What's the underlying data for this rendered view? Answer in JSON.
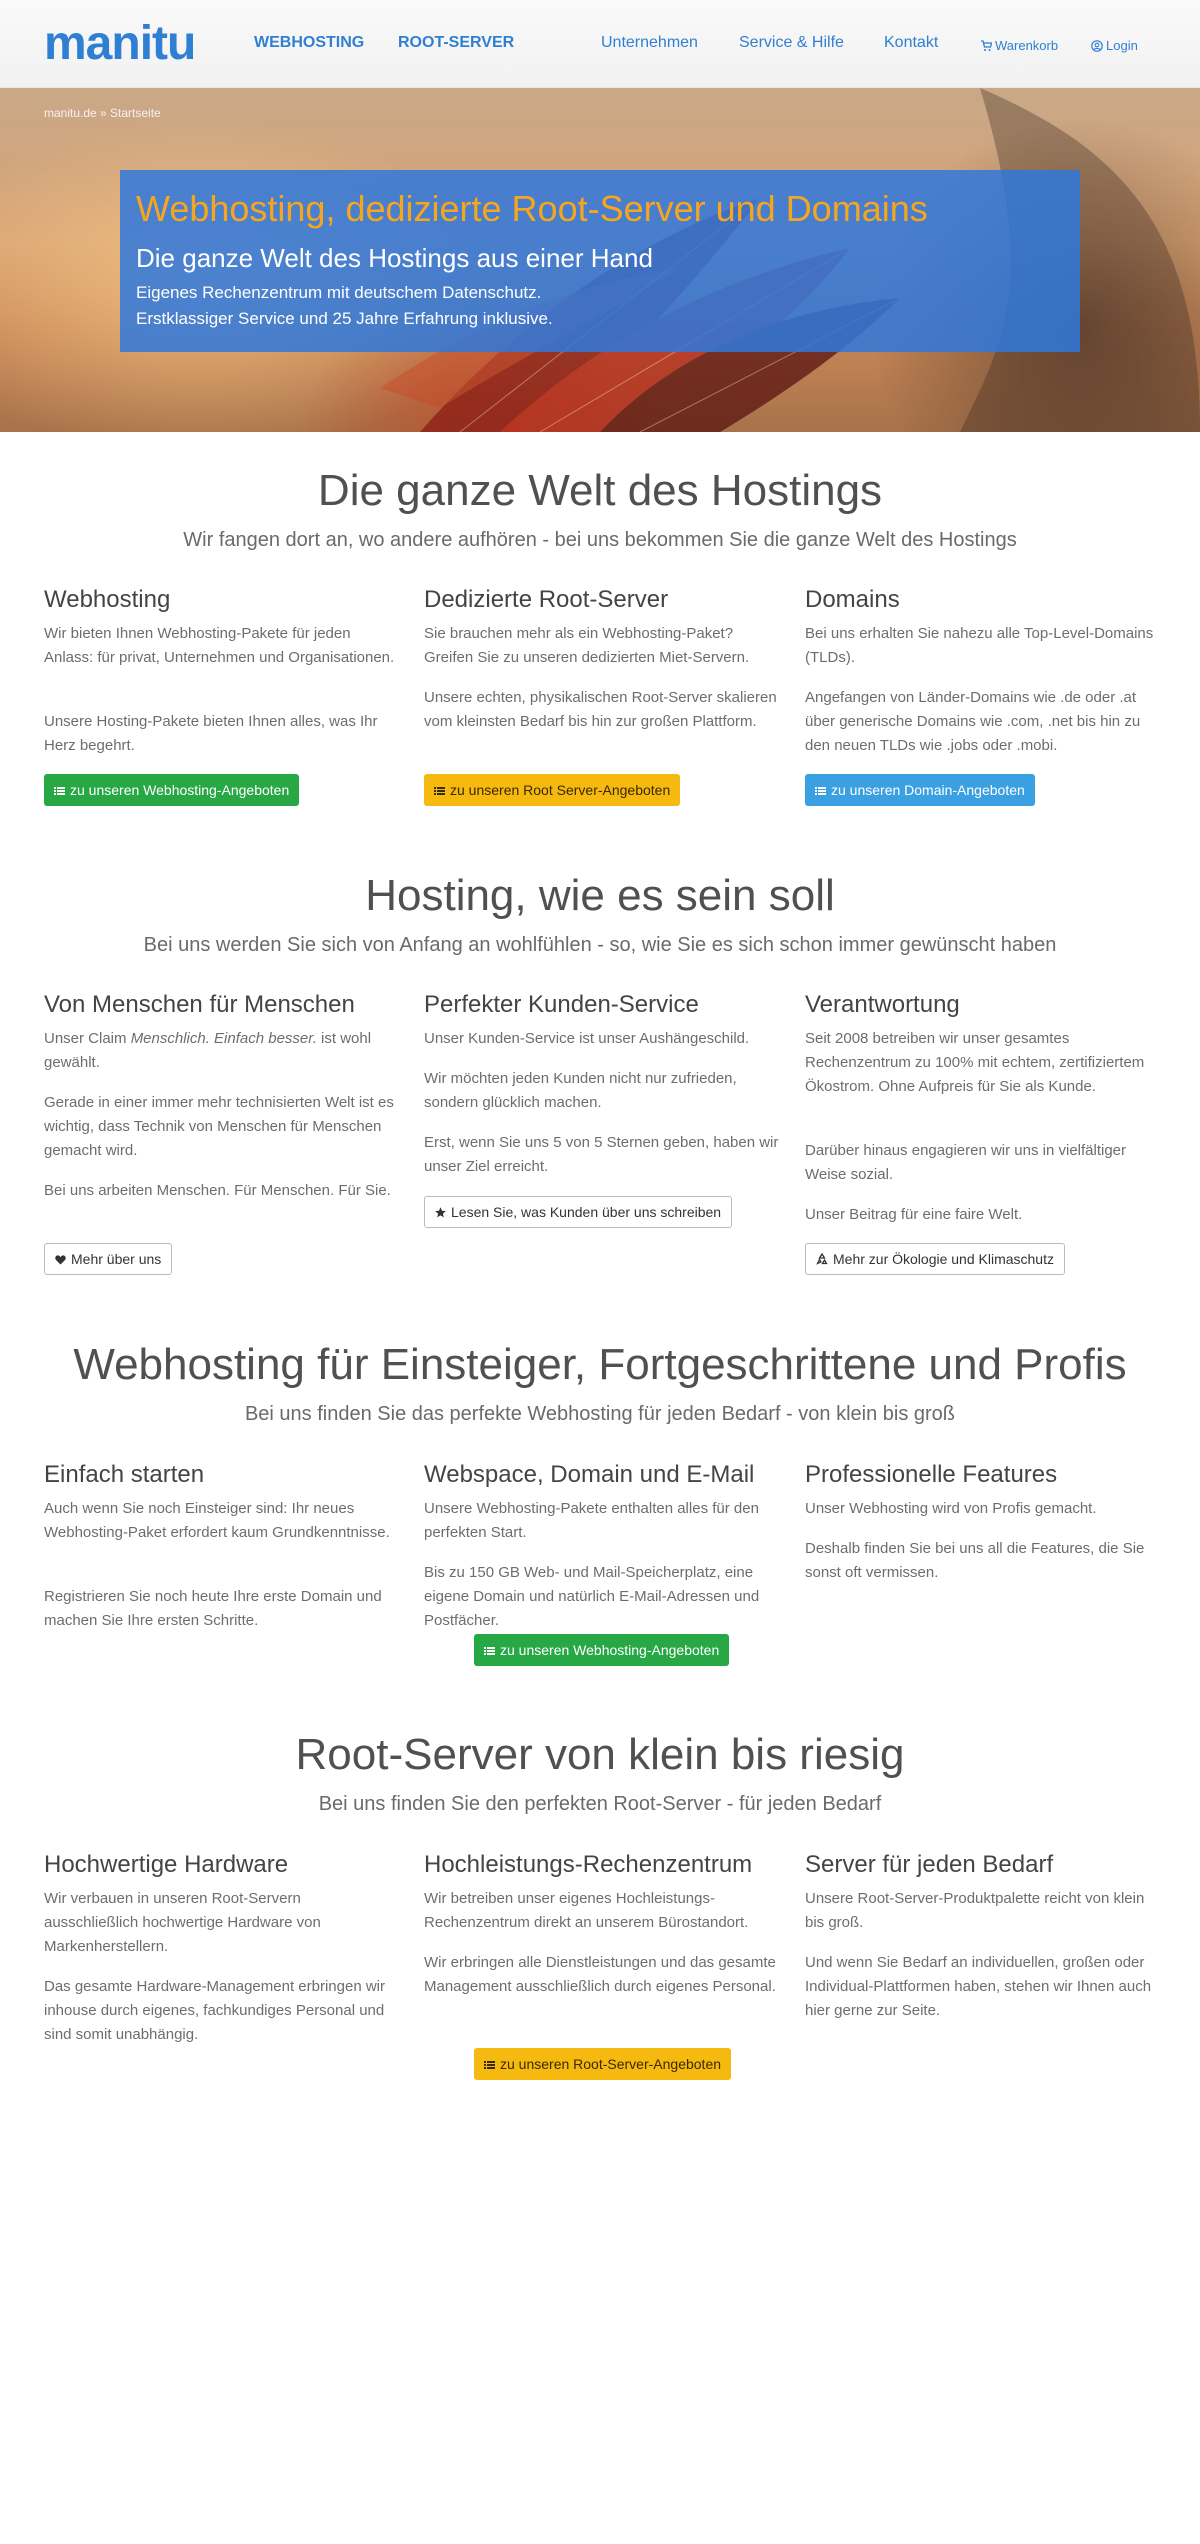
{
  "header": {
    "logo": "manitu",
    "nav_left": [
      "WEBHOSTING",
      "ROOT-SERVER"
    ],
    "nav_right": [
      "Unternehmen",
      "Service & Hilfe",
      "Kontakt"
    ],
    "cart": "Warenkorb",
    "login": "Login"
  },
  "hero": {
    "breadcrumb": "manitu.de » Startseite",
    "title": "Webhosting, dedizierte Root-Server und Domains",
    "subtitle": "Die ganze Welt des Hostings aus einer Hand",
    "line1": "Eigenes Rechenzentrum mit deutschem Datenschutz.",
    "line2": "Erstklassiger Service und 25 Jahre Erfahrung inklusive."
  },
  "sections": [
    {
      "title": "Die ganze Welt des Hostings",
      "subtitle": "Wir fangen dort an, wo andere aufhören - bei uns bekommen Sie die ganze Welt des Hostings",
      "cols": [
        {
          "heading": "Webhosting",
          "p1": "Wir bieten Ihnen Webhosting-Pakete für jeden Anlass: für privat, Unternehmen und Organisationen.",
          "p2": "Unsere Hosting-Pakete bieten Ihnen alles, was Ihr Herz begehrt.",
          "button": "zu unseren Webhosting-Angeboten"
        },
        {
          "heading": "Dedizierte Root-Server",
          "p1": "Sie brauchen mehr als ein Webhosting-Paket? Greifen Sie zu unseren dedizierten Miet-Servern.",
          "p2": "Unsere echten, physikalischen Root-Server skalieren vom kleinsten Bedarf bis hin zur großen Plattform.",
          "button": "zu unseren Root Server-Angeboten"
        },
        {
          "heading": "Domains",
          "p1": "Bei uns erhalten Sie nahezu alle Top-Level-Domains (TLDs).",
          "p2": "Angefangen von Länder-Domains wie .de oder .at über generische Domains wie .com, .net bis hin zu den neuen TLDs wie .jobs oder .mobi.",
          "button": "zu unseren Domain-Angeboten"
        }
      ]
    },
    {
      "title": "Hosting, wie es sein soll",
      "subtitle": "Bei uns werden Sie sich von Anfang an wohlfühlen - so, wie Sie es sich schon immer gewünscht haben",
      "cols": [
        {
          "heading": "Von Menschen für Menschen",
          "p1_pre": "Unser Claim ",
          "p1_em": "Menschlich. Einfach besser.",
          "p1_post": " ist wohl gewählt.",
          "p2": "Gerade in einer immer mehr technisierten Welt ist es wichtig, dass Technik von Menschen für Menschen gemacht wird.",
          "p3": "Bei uns arbeiten Menschen. Für Menschen. Für Sie.",
          "button": "Mehr über uns"
        },
        {
          "heading": "Perfekter Kunden-Service",
          "p1": "Unser Kunden-Service ist unser Aushängeschild.",
          "p2": "Wir möchten jeden Kunden nicht nur zufrieden, sondern glücklich machen.",
          "p3": "Erst, wenn Sie uns 5 von 5 Sternen geben, haben wir unser Ziel erreicht.",
          "button": "Lesen Sie, was Kunden über uns schreiben"
        },
        {
          "heading": "Verantwortung",
          "p1": "Seit 2008 betreiben wir unser gesamtes Rechenzentrum zu 100% mit echtem, zertifiziertem Ökostrom. Ohne Aufpreis für Sie als Kunde.",
          "p2": "Darüber hinaus engagieren wir uns in vielfältiger Weise sozial.",
          "p3": "Unser Beitrag für eine faire Welt.",
          "button": "Mehr zur Ökologie und Klimaschutz"
        }
      ]
    },
    {
      "title": "Webhosting für Einsteiger, Fortgeschrittene und Profis",
      "subtitle": "Bei uns finden Sie das perfekte Webhosting für jeden Bedarf - von klein bis groß",
      "cols": [
        {
          "heading": "Einfach starten",
          "p1": "Auch wenn Sie noch Einsteiger sind: Ihr neues Webhosting-Paket erfordert kaum Grundkenntnisse.",
          "p2": "Registrieren Sie noch heute Ihre erste Domain und machen Sie Ihre ersten Schritte."
        },
        {
          "heading": "Webspace, Domain und E-Mail",
          "p1": "Unsere Webhosting-Pakete enthalten alles für den perfekten Start.",
          "p2": "Bis zu 150 GB Web- und Mail-Speicherplatz, eine eigene Domain und natürlich E-Mail-Adressen und Postfächer."
        },
        {
          "heading": "Professionelle Features",
          "p1": "Unser Webhosting wird von Profis gemacht.",
          "p2": "Deshalb finden Sie bei uns all die Features, die Sie sonst oft vermissen."
        }
      ],
      "button": "zu unseren Webhosting-Angeboten"
    },
    {
      "title": "Root-Server von klein bis riesig",
      "subtitle": "Bei uns finden Sie den perfekten Root-Server - für jeden Bedarf",
      "cols": [
        {
          "heading": "Hochwertige Hardware",
          "p1": "Wir verbauen in unseren Root-Servern ausschließlich hochwertige Hardware von Markenherstellern.",
          "p2": "Das gesamte Hardware-Management erbringen wir inhouse durch eigenes, fachkundiges Personal und sind somit unabhängig."
        },
        {
          "heading": "Hochleistungs-Rechenzentrum",
          "p1": "Wir betreiben unser eigenes Hochleistungs-Rechenzentrum direkt an unserem Bürostandort.",
          "p2": "Wir erbringen alle Dienstleistungen und das gesamte Management ausschließlich durch eigenes Personal."
        },
        {
          "heading": "Server für jeden Bedarf",
          "p1": "Unsere Root-Server-Produktpalette reicht von klein bis groß.",
          "p2": "Und wenn Sie Bedarf an individuellen, großen oder Individual-Plattformen haben, stehen wir Ihnen auch hier gerne zur Seite."
        }
      ],
      "button": "zu unseren Root-Server-Angeboten"
    }
  ],
  "colors": {
    "brand": "#2f7fd3",
    "accent": "#f6a61e",
    "green": "#28a745",
    "yellow": "#f5b90f",
    "blue": "#3aa0e2"
  },
  "icons": [
    "cart-icon",
    "user-circle-icon",
    "list-icon",
    "heart-icon",
    "star-icon",
    "recycle-icon"
  ]
}
